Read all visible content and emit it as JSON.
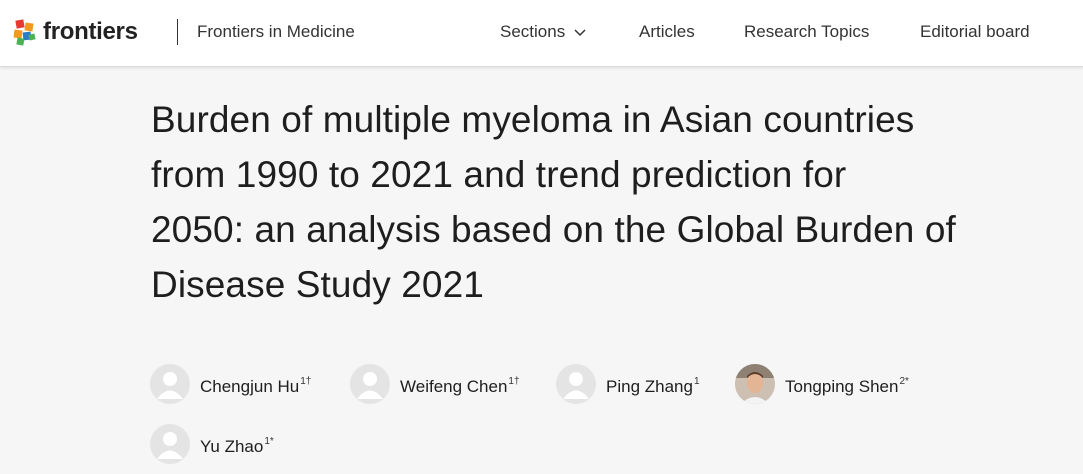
{
  "header": {
    "logo_text": "frontiers",
    "journal_name": "Frontiers in Medicine",
    "nav": [
      {
        "label": "Sections",
        "has_dropdown": true
      },
      {
        "label": "Articles"
      },
      {
        "label": "Research Topics"
      },
      {
        "label": "Editorial board"
      }
    ],
    "icons": {
      "logo": "frontiers-logo-icon",
      "dropdown": "chevron-down-icon"
    }
  },
  "article": {
    "title_lines": [
      "Burden of multiple myeloma in Asian countries",
      "from 1990 to 2021 and trend prediction for",
      "2050: an analysis based on the Global Burden of",
      "Disease Study 2021"
    ]
  },
  "authors": [
    {
      "name": "Chengjun Hu",
      "sup": "1†",
      "avatar": "default-avatar-icon"
    },
    {
      "name": "Weifeng Chen",
      "sup": "1†",
      "avatar": "default-avatar-icon"
    },
    {
      "name": "Ping Zhang",
      "sup": "1",
      "avatar": "default-avatar-icon"
    },
    {
      "name": "Tongping Shen",
      "sup": "2*",
      "avatar": "photo-avatar"
    },
    {
      "name": "Yu Zhao",
      "sup": "1*",
      "avatar": "default-avatar-icon"
    }
  ],
  "colors": {
    "background": "#f6f6f6",
    "header_bg": "#ffffff",
    "text": "#1e1e1e",
    "avatar_bg": "#e4e4e4",
    "avatar_silhouette": "#ffffff",
    "logo_red": "#e63a2e",
    "logo_orange": "#f39a1e",
    "logo_blue": "#2b7bd0",
    "logo_green": "#4bb253"
  }
}
